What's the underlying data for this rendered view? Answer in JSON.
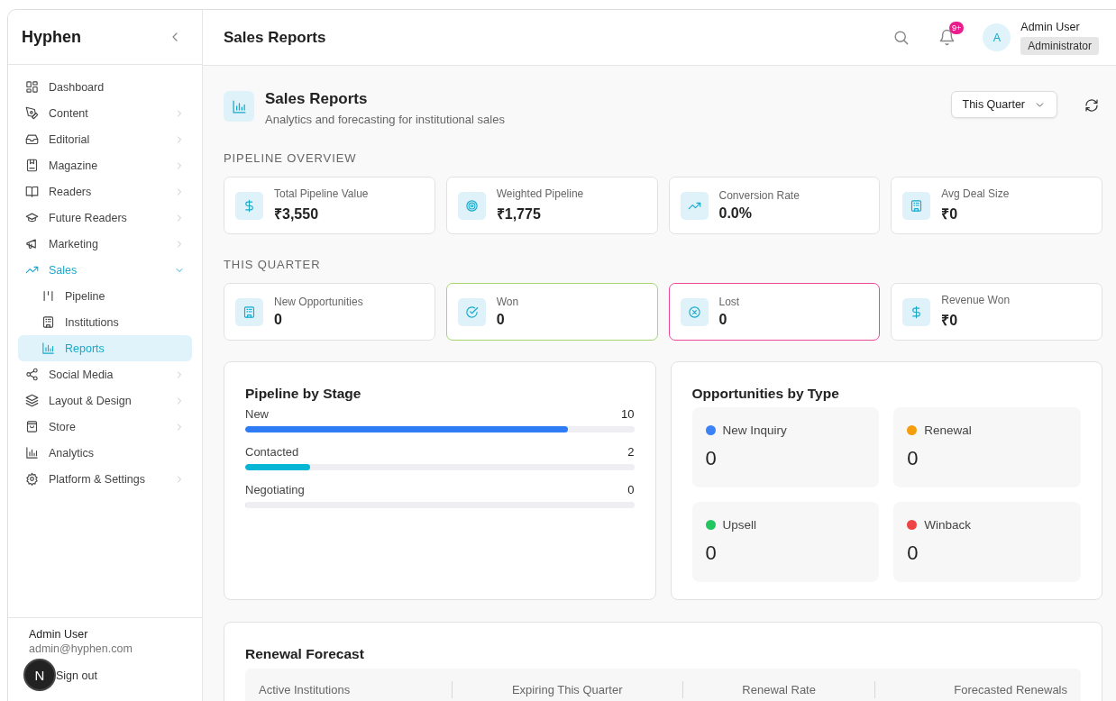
{
  "sidebar": {
    "brand": "Hyphen",
    "items": [
      {
        "label": "Dashboard",
        "chevron": false,
        "expanded": false
      },
      {
        "label": "Content",
        "chevron": true,
        "expanded": false
      },
      {
        "label": "Editorial",
        "chevron": true,
        "expanded": false
      },
      {
        "label": "Magazine",
        "chevron": true,
        "expanded": false
      },
      {
        "label": "Readers",
        "chevron": true,
        "expanded": false
      },
      {
        "label": "Future Readers",
        "chevron": true,
        "expanded": false
      },
      {
        "label": "Marketing",
        "chevron": true,
        "expanded": false
      },
      {
        "label": "Sales",
        "chevron": true,
        "expanded": true,
        "children": [
          {
            "label": "Pipeline",
            "selected": false
          },
          {
            "label": "Institutions",
            "selected": false
          },
          {
            "label": "Reports",
            "selected": true
          }
        ]
      },
      {
        "label": "Social Media",
        "chevron": true,
        "expanded": false
      },
      {
        "label": "Layout & Design",
        "chevron": true,
        "expanded": false
      },
      {
        "label": "Store",
        "chevron": true,
        "expanded": false
      },
      {
        "label": "Analytics",
        "chevron": false,
        "expanded": false
      },
      {
        "label": "Platform & Settings",
        "chevron": true,
        "expanded": false
      }
    ],
    "footer": {
      "name": "Admin User",
      "email": "admin@hyphen.com",
      "sign_out": "Sign out"
    }
  },
  "dev_badge": "N",
  "header": {
    "title": "Sales Reports",
    "notification_count": "9+",
    "avatar_initial": "A",
    "user_name": "Admin User",
    "user_role": "Administrator"
  },
  "page": {
    "title": "Sales Reports",
    "subtitle": "Analytics and forecasting for institutional sales",
    "period": "This Quarter"
  },
  "pipeline_overview": {
    "heading": "PIPELINE OVERVIEW",
    "cards": [
      {
        "label": "Total Pipeline Value",
        "value": "₹3,550"
      },
      {
        "label": "Weighted Pipeline",
        "value": "₹1,775"
      },
      {
        "label": "Conversion Rate",
        "value": "0.0%"
      },
      {
        "label": "Avg Deal Size",
        "value": "₹0"
      }
    ]
  },
  "this_quarter": {
    "heading": "THIS QUARTER",
    "cards": [
      {
        "label": "New Opportunities",
        "value": "0"
      },
      {
        "label": "Won",
        "value": "0",
        "color": "#a6d672"
      },
      {
        "label": "Lost",
        "value": "0",
        "color": "#ec4899"
      },
      {
        "label": "Revenue Won",
        "value": "₹0"
      }
    ]
  },
  "pipeline_by_stage": {
    "title": "Pipeline by Stage",
    "stages": [
      {
        "label": "New",
        "count": "10",
        "level": 0.83,
        "color": "#2f7df6"
      },
      {
        "label": "Contacted",
        "count": "2",
        "level": 0.167,
        "color": "#06b6d4"
      },
      {
        "label": "Negotiating",
        "count": "0",
        "level": 0
      }
    ]
  },
  "opportunities_by_type": {
    "title": "Opportunities by Type",
    "types": [
      {
        "label": "New Inquiry",
        "value": "0",
        "color": "#3b82f6"
      },
      {
        "label": "Renewal",
        "value": "0",
        "color": "#f59e0b"
      },
      {
        "label": "Upsell",
        "value": "0",
        "color": "#22c55e"
      },
      {
        "label": "Winback",
        "value": "0",
        "color": "#ef4444"
      }
    ]
  },
  "renewal_forecast": {
    "title": "Renewal Forecast",
    "columns": [
      "Active Institutions",
      "Expiring This Quarter",
      "Renewal Rate",
      "Forecasted Renewals"
    ]
  }
}
